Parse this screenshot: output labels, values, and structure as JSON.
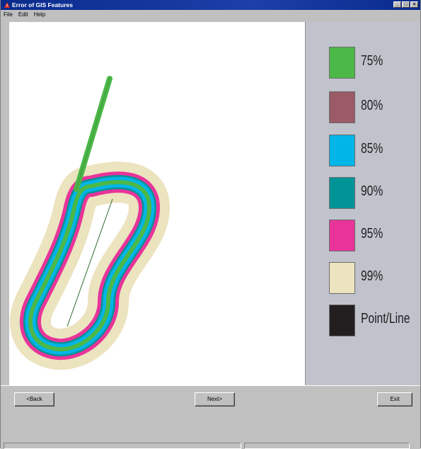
{
  "window": {
    "title": "Error of GIS Features",
    "buttons": [
      "_",
      "□",
      "×"
    ]
  },
  "menu": {
    "items": [
      "File",
      "Edit",
      "Help"
    ]
  },
  "legend": {
    "items": [
      {
        "label": "75%",
        "color": "#4cb848"
      },
      {
        "label": "80%",
        "color": "#9a5a66"
      },
      {
        "label": "85%",
        "color": "#00b5e8"
      },
      {
        "label": "90%",
        "color": "#009498"
      },
      {
        "label": "95%",
        "color": "#e8349a"
      },
      {
        "label": "99%",
        "color": "#ece3bf"
      },
      {
        "label": "Point/Line",
        "color": "#231f20"
      }
    ]
  },
  "buttons": {
    "back": "<Back",
    "next": "Next>",
    "exit": "Exit"
  }
}
